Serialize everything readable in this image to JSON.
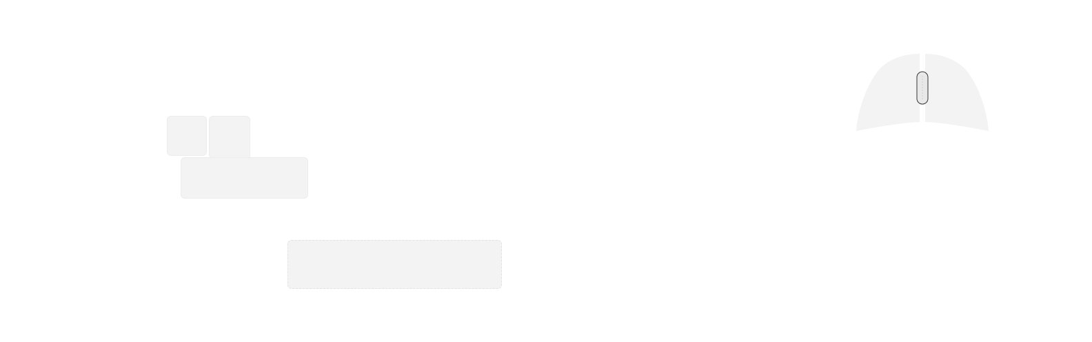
{
  "keyboard": {
    "keys": [
      {
        "name": "key-top-left",
        "label": ""
      },
      {
        "name": "key-top-right",
        "label": ""
      },
      {
        "name": "key-wide-lower",
        "label": ""
      },
      {
        "name": "key-spacebar",
        "label": ""
      }
    ],
    "key_color": "#f3f3f3"
  },
  "mouse": {
    "body_color": "#f3f3f3",
    "wheel_color": "#e8e8e8",
    "wheel_outline_color": "#333333"
  }
}
